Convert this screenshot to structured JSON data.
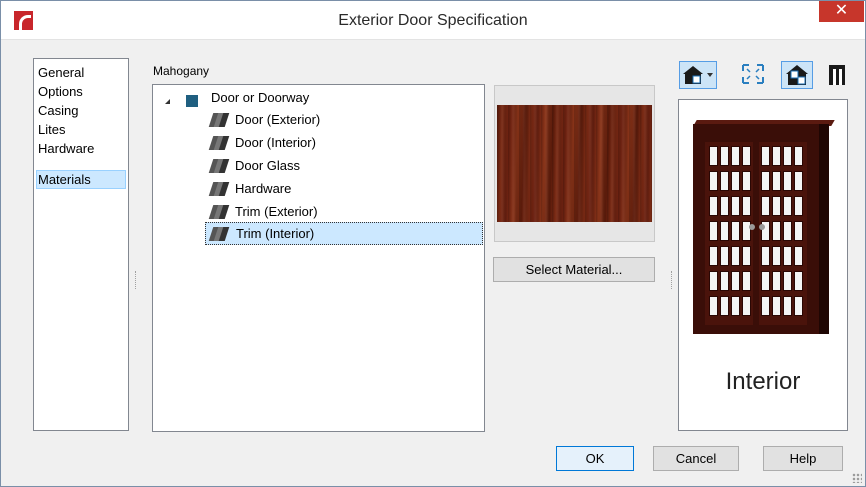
{
  "window": {
    "title": "Exterior Door Specification",
    "close_symbol": "✕"
  },
  "nav": {
    "items": [
      {
        "label": "General",
        "selected": false
      },
      {
        "label": "Options",
        "selected": false
      },
      {
        "label": "Casing",
        "selected": false
      },
      {
        "label": "Lites",
        "selected": false
      },
      {
        "label": "Hardware",
        "selected": false
      },
      {
        "label": "Materials",
        "selected": true
      }
    ]
  },
  "materials": {
    "current_material": "Mahogany",
    "root": {
      "label": "Door or Doorway",
      "icon": "swatch-icon"
    },
    "children": [
      {
        "label": "Door (Exterior)",
        "icon": "material-icon"
      },
      {
        "label": "Door (Interior)",
        "icon": "material-icon"
      },
      {
        "label": "Door Glass",
        "icon": "material-icon"
      },
      {
        "label": "Hardware",
        "icon": "material-icon"
      },
      {
        "label": "Trim (Exterior)",
        "icon": "material-icon"
      },
      {
        "label": "Trim (Interior)",
        "icon": "material-icon",
        "selected": true
      }
    ],
    "select_button": "Select Material..."
  },
  "preview": {
    "toolbar": [
      "camera-view-icon",
      "fit-view-icon",
      "side-toggle-icon",
      "frame-icon"
    ],
    "side_label": "Interior"
  },
  "buttons": {
    "ok": "OK",
    "cancel": "Cancel",
    "help": "Help"
  },
  "colors": {
    "accent": "#0078d7",
    "selection": "#cce8ff",
    "app_icon": "#c8262b",
    "wood": "#6e2412"
  }
}
